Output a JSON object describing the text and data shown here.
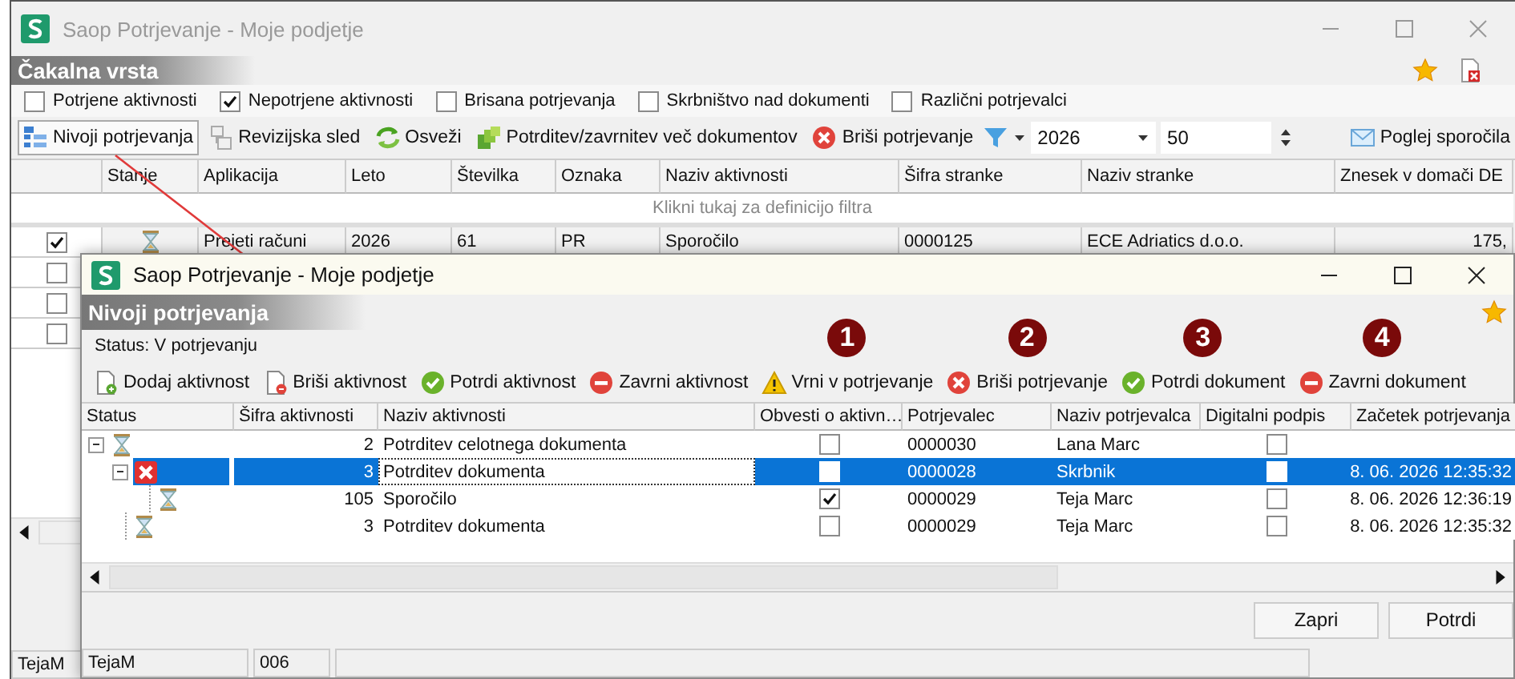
{
  "main_window": {
    "title": "Saop Potrjevanje - Moje podjetje",
    "section_title": "Čakalna vrsta",
    "filters": [
      {
        "label": "Potrjene aktivnosti",
        "checked": false
      },
      {
        "label": "Nepotrjene aktivnosti",
        "checked": true
      },
      {
        "label": "Brisana potrjevanja",
        "checked": false
      },
      {
        "label": "Skrbništvo nad dokumenti",
        "checked": false
      },
      {
        "label": "Različni potrjevalci",
        "checked": false
      }
    ],
    "toolbar": [
      {
        "label": "Nivoji potrjevanja",
        "pressed": true
      },
      {
        "label": "Revizijska sled",
        "pressed": false
      },
      {
        "label": "Osveži",
        "pressed": false
      },
      {
        "label": "Potrditev/zavrnitev več dokumentov",
        "pressed": false
      },
      {
        "label": "Briši potrjevanje",
        "pressed": false
      }
    ],
    "year": "2026",
    "count": "50",
    "messages_button": "Poglej sporočila",
    "table": {
      "columns": [
        "Stanje",
        "Aplikacija",
        "Leto",
        "Številka",
        "Oznaka",
        "Naziv aktivnosti",
        "Šifra stranke",
        "Naziv stranke",
        "Znesek v domači DE"
      ],
      "filter_hint": "Klikni tukaj za definicijo filtra",
      "rows": [
        {
          "checked": true,
          "kind": "waiting",
          "cells": [
            "Prejeti računi",
            "2026",
            "61",
            "PR",
            "Sporočilo",
            "0000125",
            "ECE Adriatics d.o.o.",
            "175,"
          ]
        },
        {
          "checked": false
        },
        {
          "checked": false
        },
        {
          "checked": false
        }
      ]
    },
    "status_bar": [
      "TejaM"
    ]
  },
  "dialog": {
    "title": "Saop Potrjevanje - Moje podjetje",
    "section_title": "Nivoji potrjevanja",
    "status": "Status: V potrjevanju",
    "toolbar": [
      {
        "label": "Dodaj aktivnost"
      },
      {
        "label": "Briši aktivnost"
      },
      {
        "label": "Potrdi aktivnost"
      },
      {
        "label": "Zavrni aktivnost"
      },
      {
        "label": "Vrni v potrjevanje",
        "marker": "1"
      },
      {
        "label": "Briši potrjevanje",
        "marker": "2"
      },
      {
        "label": "Potrdi dokument",
        "marker": "3"
      },
      {
        "label": "Zavrni dokument",
        "marker": "4"
      }
    ],
    "table": {
      "columns": [
        "Status",
        "Šifra aktivnosti",
        "Naziv aktivnosti",
        "Obvesti o aktivn…",
        "Potrjevalec",
        "Naziv potrjevalca",
        "Digitalni podpis",
        "Začetek potrjevanja"
      ],
      "rows": [
        {
          "kind": "waiting",
          "code": "2",
          "name": "Potrditev celotnega dokumenta",
          "notify": false,
          "approver": "0000030",
          "approver_name": "Lana Marc",
          "signature": false,
          "selected": false,
          "expanded": true,
          "children": [
            {
              "kind": "rejected",
              "code": "3",
              "name": "Potrditev dokumenta",
              "notify": false,
              "approver": "0000028",
              "approver_name": "Skrbnik",
              "signature": false,
              "start": "8. 06. 2026 12:35:32",
              "selected": true,
              "expanded": true,
              "children": [
                {
                  "kind": "waiting",
                  "code": "105",
                  "name": "Sporočilo",
                  "notify": true,
                  "approver": "0000029",
                  "approver_name": "Teja Marc",
                  "signature": false,
                  "start": "8. 06. 2026 12:36:19",
                  "selected": false
                }
              ]
            },
            {
              "kind": "waiting",
              "code": "3",
              "name": "Potrditev dokumenta",
              "notify": false,
              "approver": "0000029",
              "approver_name": "Teja Marc",
              "signature": false,
              "start": "8. 06. 2026 12:35:32",
              "selected": false
            }
          ]
        }
      ]
    },
    "buttons": [
      "Zapri",
      "Potrdi"
    ],
    "status_bar": [
      "TejaM",
      "006"
    ]
  }
}
